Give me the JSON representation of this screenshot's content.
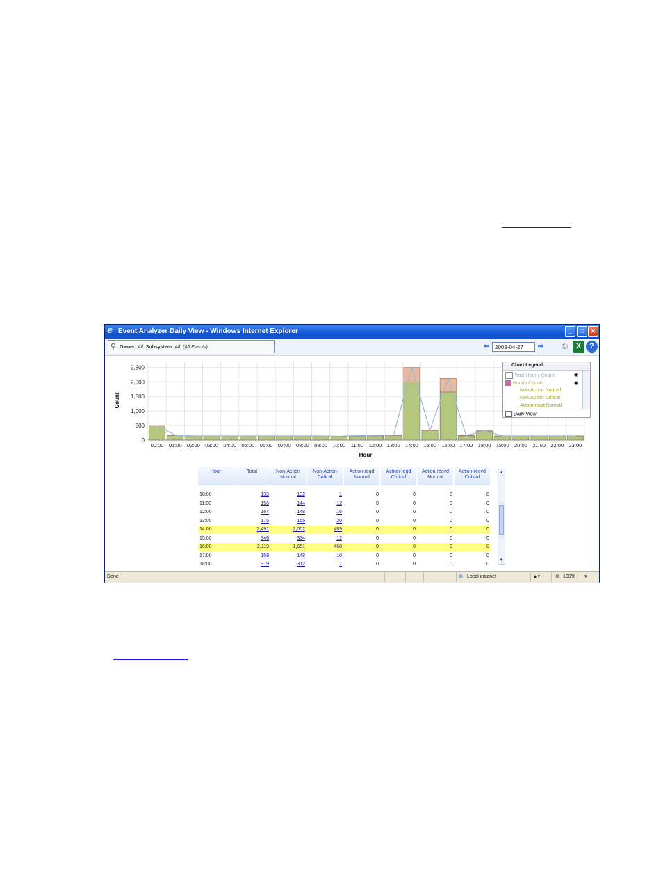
{
  "window": {
    "title": "Event Analyzer Daily View - Windows Internet Explorer",
    "controls": [
      "minimize",
      "maximize",
      "close"
    ]
  },
  "filter": {
    "owner_label": "Owner:",
    "owner_value": "All",
    "subsystem_label": "Subsystem:",
    "subsystem_value": "All",
    "events_value": "(All Events)"
  },
  "date": {
    "value": "2009-04-27"
  },
  "icons": {
    "prev": "left-arrow-icon",
    "next": "right-arrow-icon",
    "print": "printer-icon",
    "excel": "excel-icon",
    "help": "help-icon"
  },
  "legend": {
    "title": "Chart Legend",
    "items": [
      {
        "label": "Total Hourly Count",
        "color": "#9aa8c4"
      },
      {
        "label": "Hourly Counts",
        "color": "#b8a050"
      },
      {
        "label": "Non-Action Normal",
        "color": "#a0a020"
      },
      {
        "label": "Non-Action Critical",
        "color": "#a0a020"
      },
      {
        "label": "Action-reqd Normal",
        "color": "#a0a020"
      }
    ],
    "footer": "Daily View"
  },
  "chart_data": {
    "type": "bar",
    "title": "",
    "xlabel": "Hour",
    "ylabel": "Count",
    "ylim": [
      0,
      2700
    ],
    "yticks": [
      0,
      500,
      1000,
      1500,
      2000,
      2500
    ],
    "ytick_labels": [
      "0",
      "500",
      "1,000",
      "1,500",
      "2,000",
      "2,500"
    ],
    "categories": [
      "00:00",
      "01:00",
      "02:00",
      "03:00",
      "04:00",
      "05:00",
      "06:00",
      "07:00",
      "08:00",
      "09:00",
      "10:00",
      "11:00",
      "12:00",
      "13:00",
      "14:00",
      "15:00",
      "16:00",
      "17:00",
      "18:00",
      "19:00",
      "20:00",
      "21:00",
      "22:00",
      "23:00"
    ],
    "series": [
      {
        "name": "Non-Action Normal",
        "values": [
          490,
          160,
          140,
          140,
          140,
          140,
          140,
          140,
          140,
          140,
          132,
          144,
          148,
          155,
          2002,
          334,
          1651,
          148,
          312,
          140,
          140,
          140,
          140,
          140
        ]
      },
      {
        "name": "Non-Action Critical",
        "values": [
          10,
          5,
          5,
          5,
          5,
          5,
          5,
          5,
          5,
          5,
          1,
          12,
          16,
          20,
          489,
          12,
          468,
          10,
          7,
          5,
          5,
          5,
          5,
          5
        ]
      }
    ],
    "line": {
      "name": "Total Hourly Count",
      "values": [
        500,
        165,
        145,
        145,
        145,
        145,
        145,
        145,
        145,
        145,
        133,
        156,
        164,
        175,
        2491,
        346,
        2119,
        158,
        319,
        145,
        145,
        145,
        145,
        145
      ]
    },
    "colors": {
      "normal": "#b5c77f",
      "critical": "#e8b8a0",
      "line": "#9ab8d8",
      "grid": "#e4e4e4"
    },
    "grid": true,
    "legend": "right"
  },
  "table": {
    "headers": [
      [
        "Hour"
      ],
      [
        "Total"
      ],
      [
        "Non-Action",
        "Normal"
      ],
      [
        "Non-Action",
        "Critical"
      ],
      [
        "Action-reqd",
        "Normal"
      ],
      [
        "Action-reqd",
        "Critical"
      ],
      [
        "Action-recvd",
        "Normal"
      ],
      [
        "Action-recvd",
        "Critical"
      ]
    ],
    "rows": [
      {
        "hour": "10:00",
        "total": "133",
        "nan": "132",
        "nac": "1",
        "arn": "0",
        "arc": "0",
        "acn": "0",
        "acc": "0",
        "highlight": false
      },
      {
        "hour": "11:00",
        "total": "156",
        "nan": "144",
        "nac": "12",
        "arn": "0",
        "arc": "0",
        "acn": "0",
        "acc": "0",
        "highlight": false
      },
      {
        "hour": "12:00",
        "total": "164",
        "nan": "148",
        "nac": "16",
        "arn": "0",
        "arc": "0",
        "acn": "0",
        "acc": "0",
        "highlight": false
      },
      {
        "hour": "13:00",
        "total": "175",
        "nan": "155",
        "nac": "20",
        "arn": "0",
        "arc": "0",
        "acn": "0",
        "acc": "0",
        "highlight": false
      },
      {
        "hour": "14:00",
        "total": "2,491",
        "nan": "2,002",
        "nac": "489",
        "arn": "0",
        "arc": "0",
        "acn": "0",
        "acc": "0",
        "highlight": true
      },
      {
        "hour": "15:00",
        "total": "346",
        "nan": "334",
        "nac": "12",
        "arn": "0",
        "arc": "0",
        "acn": "0",
        "acc": "0",
        "highlight": false
      },
      {
        "hour": "16:00",
        "total": "2,119",
        "nan": "1,651",
        "nac": "468",
        "arn": "0",
        "arc": "0",
        "acn": "0",
        "acc": "0",
        "highlight": true
      },
      {
        "hour": "17:00",
        "total": "158",
        "nan": "148",
        "nac": "10",
        "arn": "0",
        "arc": "0",
        "acn": "0",
        "acc": "0",
        "highlight": false
      },
      {
        "hour": "18:00",
        "total": "319",
        "nan": "312",
        "nac": "7",
        "arn": "0",
        "arc": "0",
        "acn": "0",
        "acc": "0",
        "highlight": false
      }
    ]
  },
  "status": {
    "left": "Done",
    "zone": "Local intranet",
    "zoom": "100%"
  }
}
